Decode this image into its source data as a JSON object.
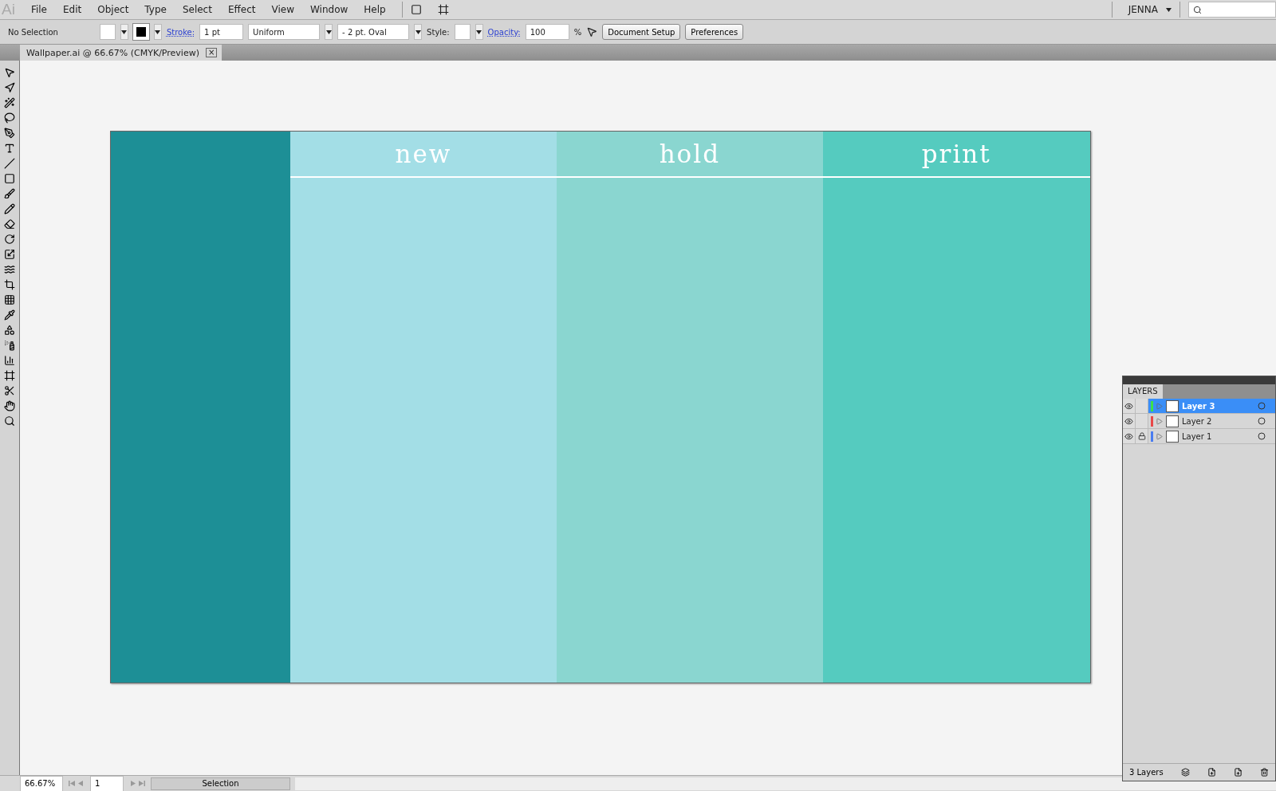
{
  "app_logo": "Ai",
  "menu": [
    "File",
    "Edit",
    "Object",
    "Type",
    "Select",
    "Effect",
    "View",
    "Window",
    "Help"
  ],
  "workspace": {
    "user": "JENNA"
  },
  "control_bar": {
    "selection": "No Selection",
    "stroke_label": "Stroke:",
    "stroke_weight": "1 pt",
    "profile": "Uniform",
    "brush": "-   2 pt. Oval",
    "style_label": "Style:",
    "opacity_label": "Opacity:",
    "opacity": "100",
    "percent": "%",
    "buttons": [
      "Document Setup",
      "Preferences"
    ]
  },
  "document_tab": {
    "title": "Wallpaper.ai @ 66.67% (CMYK/Preview)",
    "close": "×"
  },
  "artboard": {
    "columns": [
      {
        "color": "#1d8f96"
      },
      {
        "label": "new",
        "color": "#a3dee6"
      },
      {
        "label": "hold",
        "color": "#8ad6d0"
      },
      {
        "label": "print",
        "color": "#55cbbf"
      }
    ]
  },
  "layers_panel": {
    "title": "LAYERS",
    "layers": [
      {
        "name": "Layer 3",
        "selected": true,
        "visible": true,
        "locked": false,
        "color": "#3de04a"
      },
      {
        "name": "Layer 2",
        "selected": false,
        "visible": true,
        "locked": false,
        "color": "#e84848"
      },
      {
        "name": "Layer 1",
        "selected": false,
        "visible": true,
        "locked": true,
        "color": "#4a7cf0"
      }
    ],
    "count": "3 Layers"
  },
  "status_bar": {
    "zoom": "66.67%",
    "page": "1",
    "tool": "Selection"
  }
}
